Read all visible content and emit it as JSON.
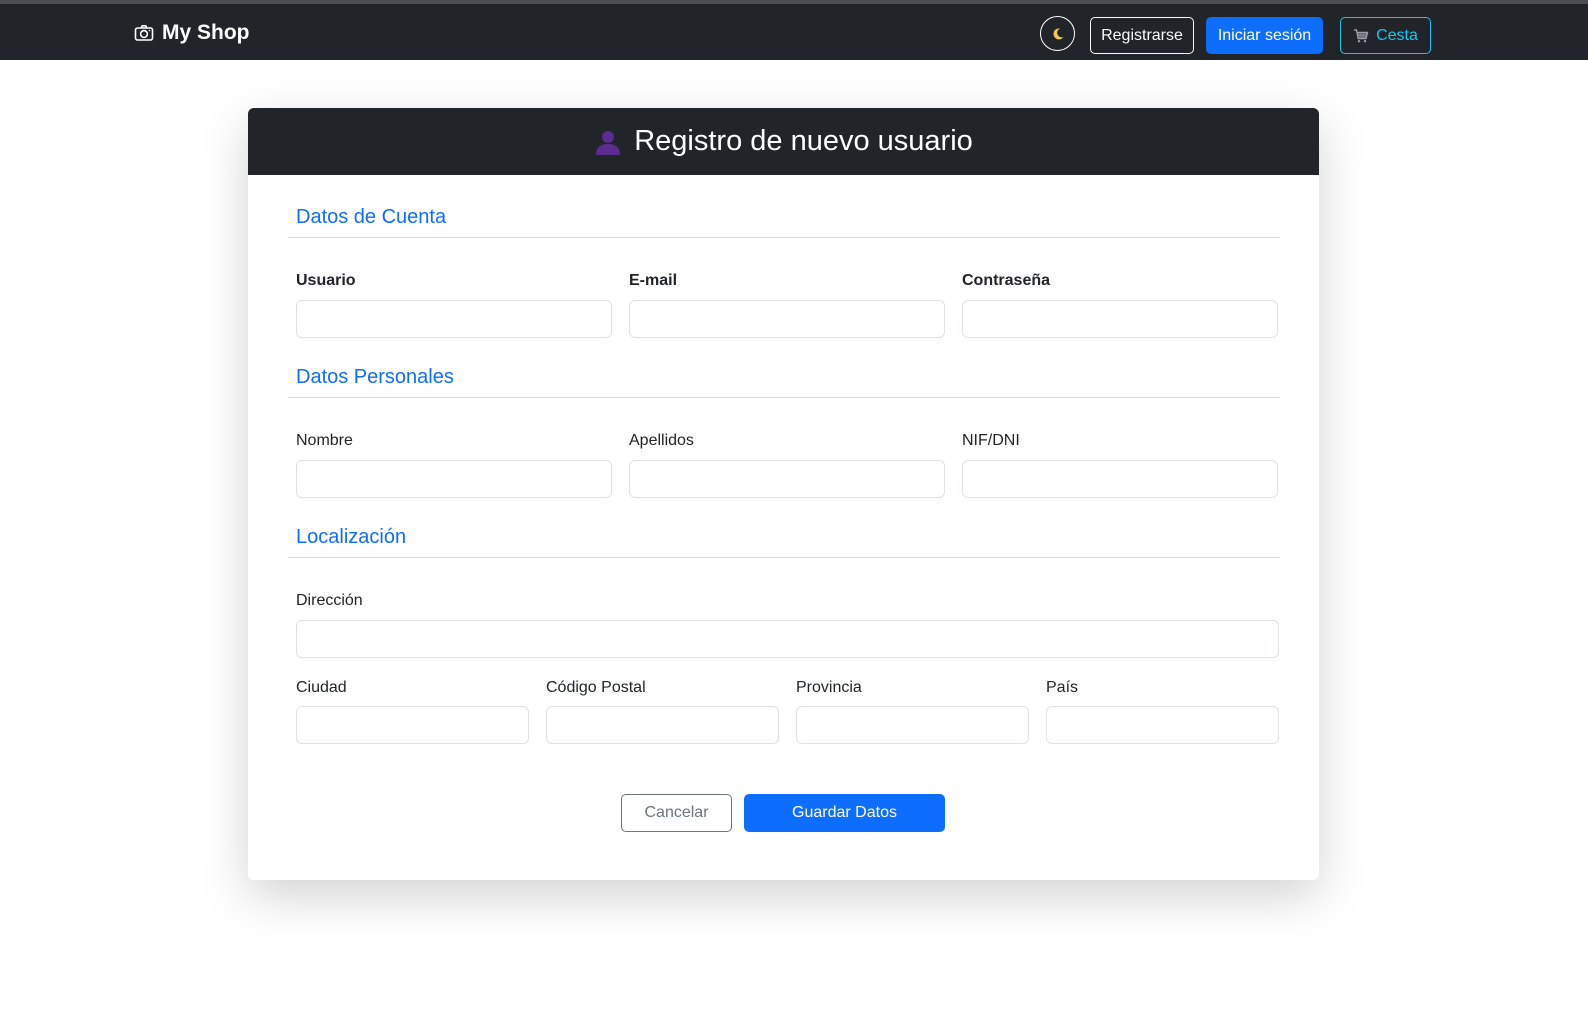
{
  "navbar": {
    "brand": "My Shop",
    "register_label": "Registrarse",
    "login_label": "Iniciar sesión",
    "cart_label": "Cesta"
  },
  "card": {
    "title": "Registro de nuevo usuario"
  },
  "sections": {
    "account": {
      "title": "Datos de Cuenta",
      "fields": {
        "usuario": "Usuario",
        "email": "E-mail",
        "password": "Contraseña"
      }
    },
    "personal": {
      "title": "Datos Personales",
      "fields": {
        "nombre": "Nombre",
        "apellidos": "Apellidos",
        "nif": "NIF/DNI"
      }
    },
    "location": {
      "title": "Localización",
      "fields": {
        "direccion": "Dirección",
        "ciudad": "Ciudad",
        "codigo_postal": "Código Postal",
        "provincia": "Provincia",
        "pais": "País"
      }
    }
  },
  "actions": {
    "cancel_label": "Cancelar",
    "save_label": "Guardar Datos"
  },
  "icons": {
    "brand": "camera-icon",
    "theme": "moon-icon",
    "cart": "cart-icon",
    "header": "user-icon"
  },
  "colors": {
    "navbar": "#212529",
    "primary": "#0d6efd",
    "info": "#0dcaf0",
    "section_title": "#0d6efd"
  }
}
